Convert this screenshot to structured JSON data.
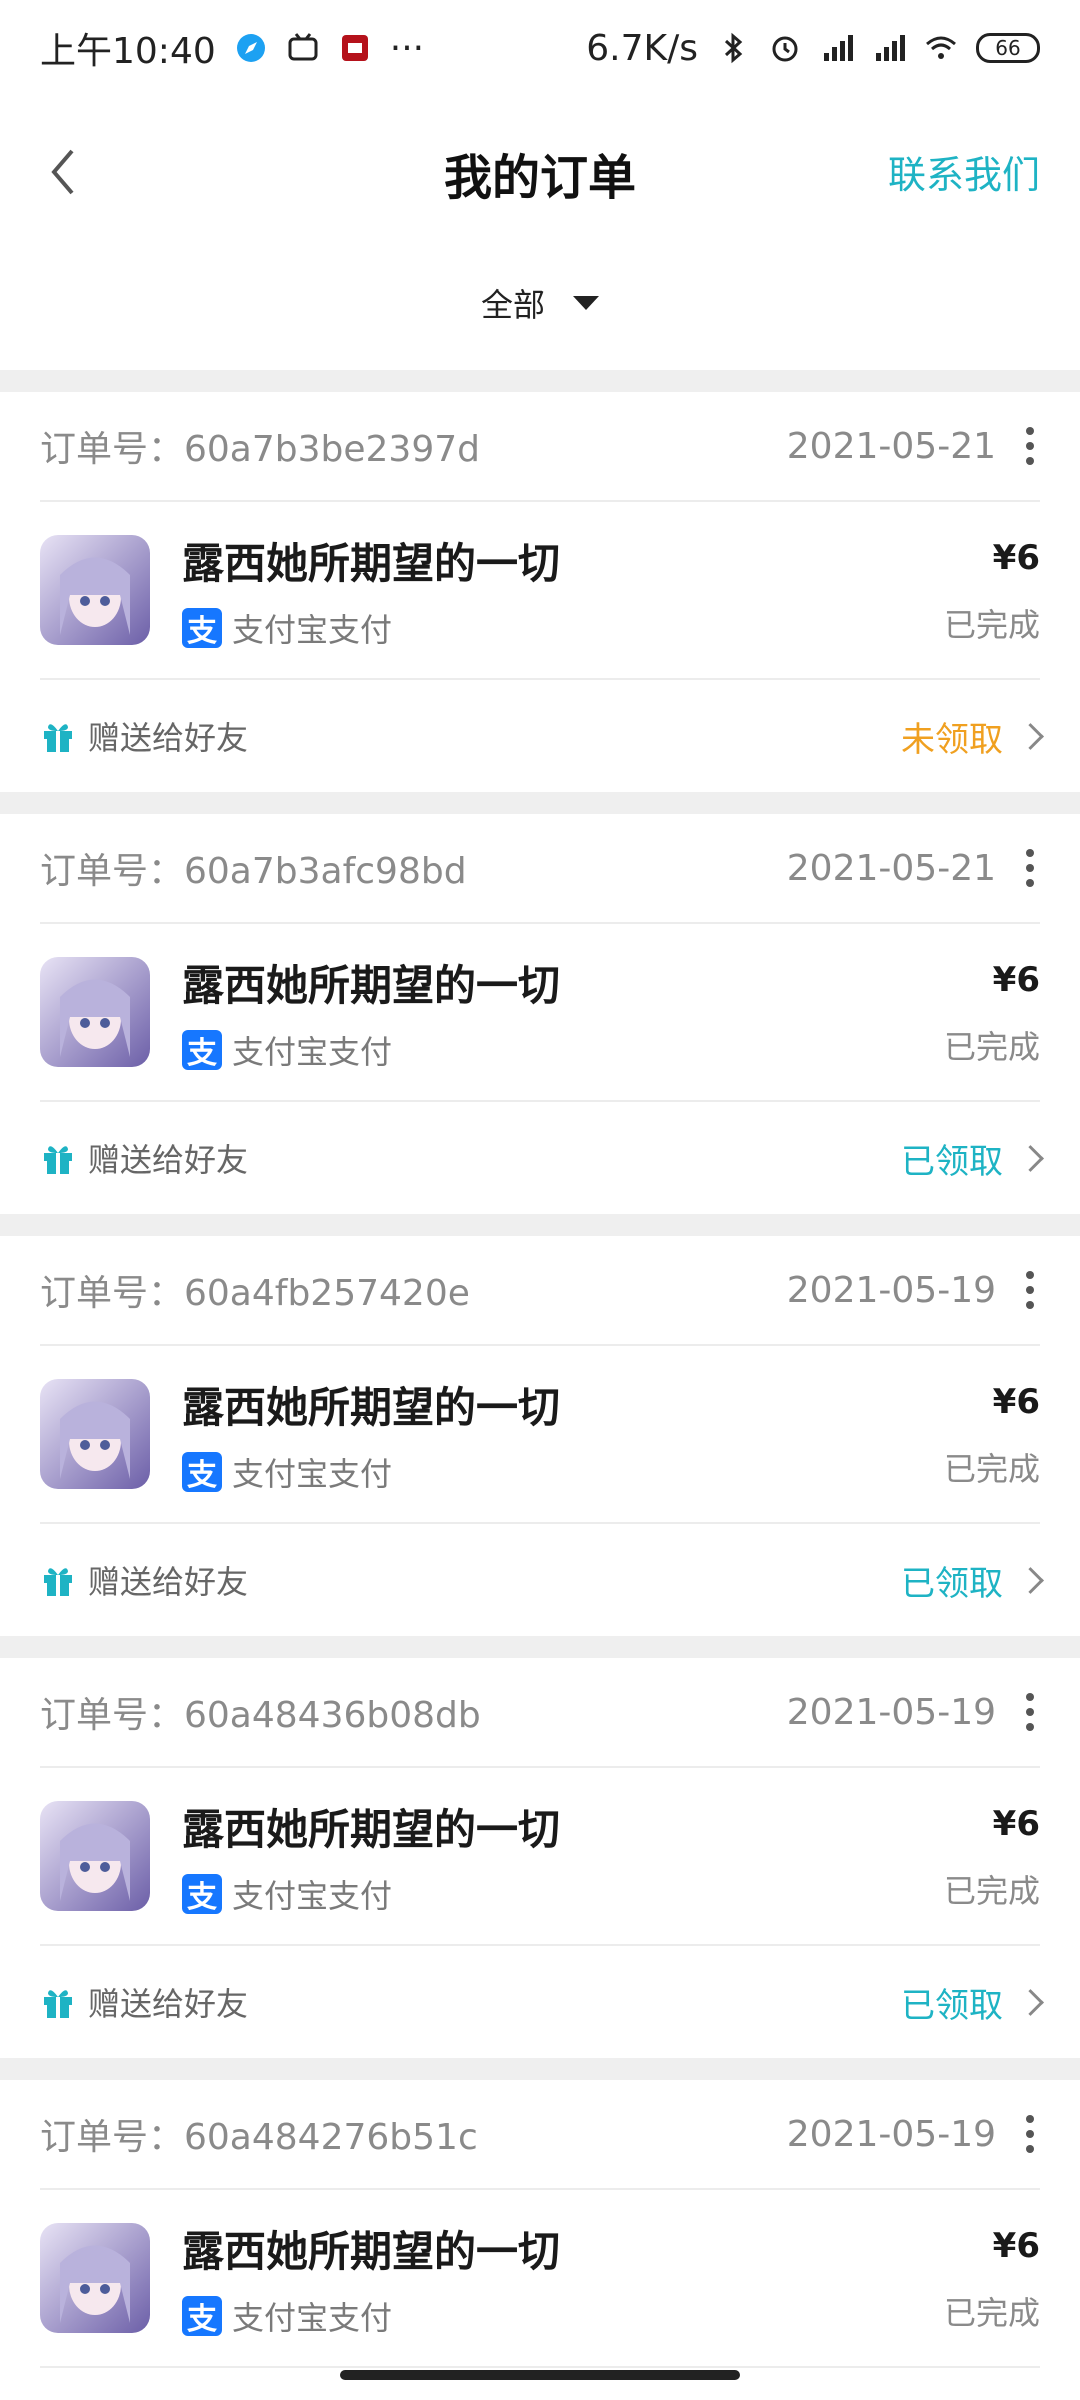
{
  "statusbar": {
    "time": "上午10:40",
    "more": "···",
    "speed": "6.7K/s",
    "battery": "66"
  },
  "header": {
    "title": "我的订单",
    "contact": "联系我们"
  },
  "filter": {
    "label": "全部"
  },
  "colors": {
    "accent": "#1eb3c4",
    "unclaimed": "#f0a020",
    "alipay": "#1677ff"
  },
  "orders": [
    {
      "order_no": "订单号：60a7b3be2397d",
      "date": "2021-05-21",
      "title": "露西她所期望的一切",
      "payment": "支付宝支付",
      "price": "¥6",
      "status": "已完成",
      "gift": "赠送给好友",
      "gift_status": "未领取"
    },
    {
      "order_no": "订单号：60a7b3afc98bd",
      "date": "2021-05-21",
      "title": "露西她所期望的一切",
      "payment": "支付宝支付",
      "price": "¥6",
      "status": "已完成",
      "gift": "赠送给好友",
      "gift_status": "已领取"
    },
    {
      "order_no": "订单号：60a4fb257420e",
      "date": "2021-05-19",
      "title": "露西她所期望的一切",
      "payment": "支付宝支付",
      "price": "¥6",
      "status": "已完成",
      "gift": "赠送给好友",
      "gift_status": "已领取"
    },
    {
      "order_no": "订单号：60a48436b08db",
      "date": "2021-05-19",
      "title": "露西她所期望的一切",
      "payment": "支付宝支付",
      "price": "¥6",
      "status": "已完成",
      "gift": "赠送给好友",
      "gift_status": "已领取"
    },
    {
      "order_no": "订单号：60a484276b51c",
      "date": "2021-05-19",
      "title": "露西她所期望的一切",
      "payment": "支付宝支付",
      "price": "¥6",
      "status": "已完成",
      "gift": "",
      "gift_status": ""
    }
  ]
}
